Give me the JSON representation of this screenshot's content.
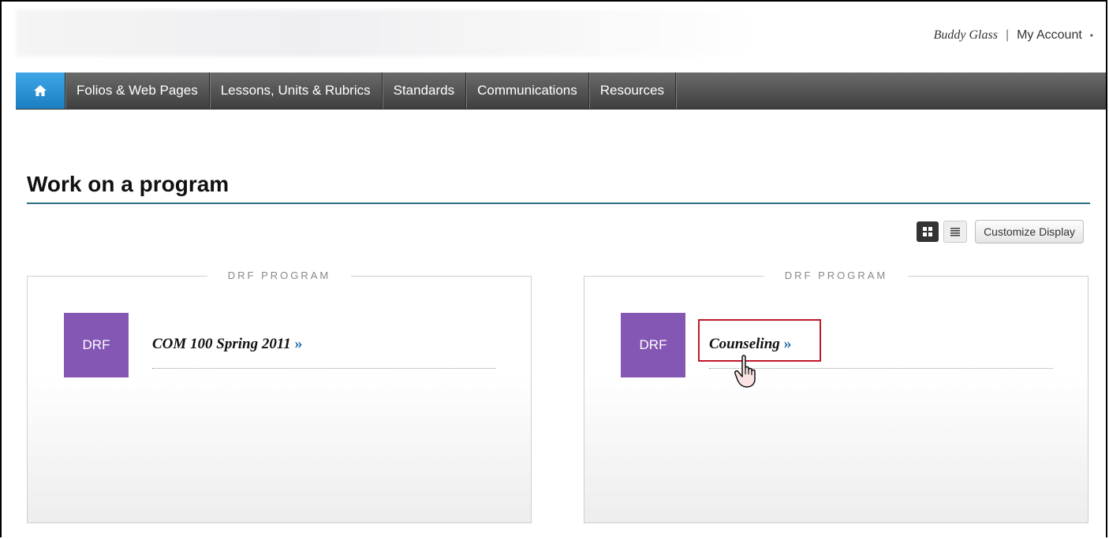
{
  "header": {
    "user_name": "Buddy Glass",
    "separator": "|",
    "account_link": "My Account",
    "account_caret": "•"
  },
  "nav": {
    "home_icon": "home-icon",
    "items": [
      "Folios & Web Pages",
      "Lessons, Units & Rubrics",
      "Standards",
      "Communications",
      "Resources"
    ]
  },
  "page": {
    "title": "Work on a program"
  },
  "display": {
    "grid_icon": "grid-view-icon",
    "list_icon": "list-view-icon",
    "customize_label": "Customize Display"
  },
  "programs": [
    {
      "legend": "DRF PROGRAM",
      "badge": "DRF",
      "name": "COM 100 Spring 2011",
      "arrow": "»"
    },
    {
      "legend": "DRF PROGRAM",
      "badge": "DRF",
      "name": "Counseling",
      "arrow": "»"
    }
  ],
  "colors": {
    "nav_home": "#1b7fc2",
    "badge": "#8557b4",
    "highlight": "#c0182b",
    "title_rule": "#2b6e85"
  }
}
